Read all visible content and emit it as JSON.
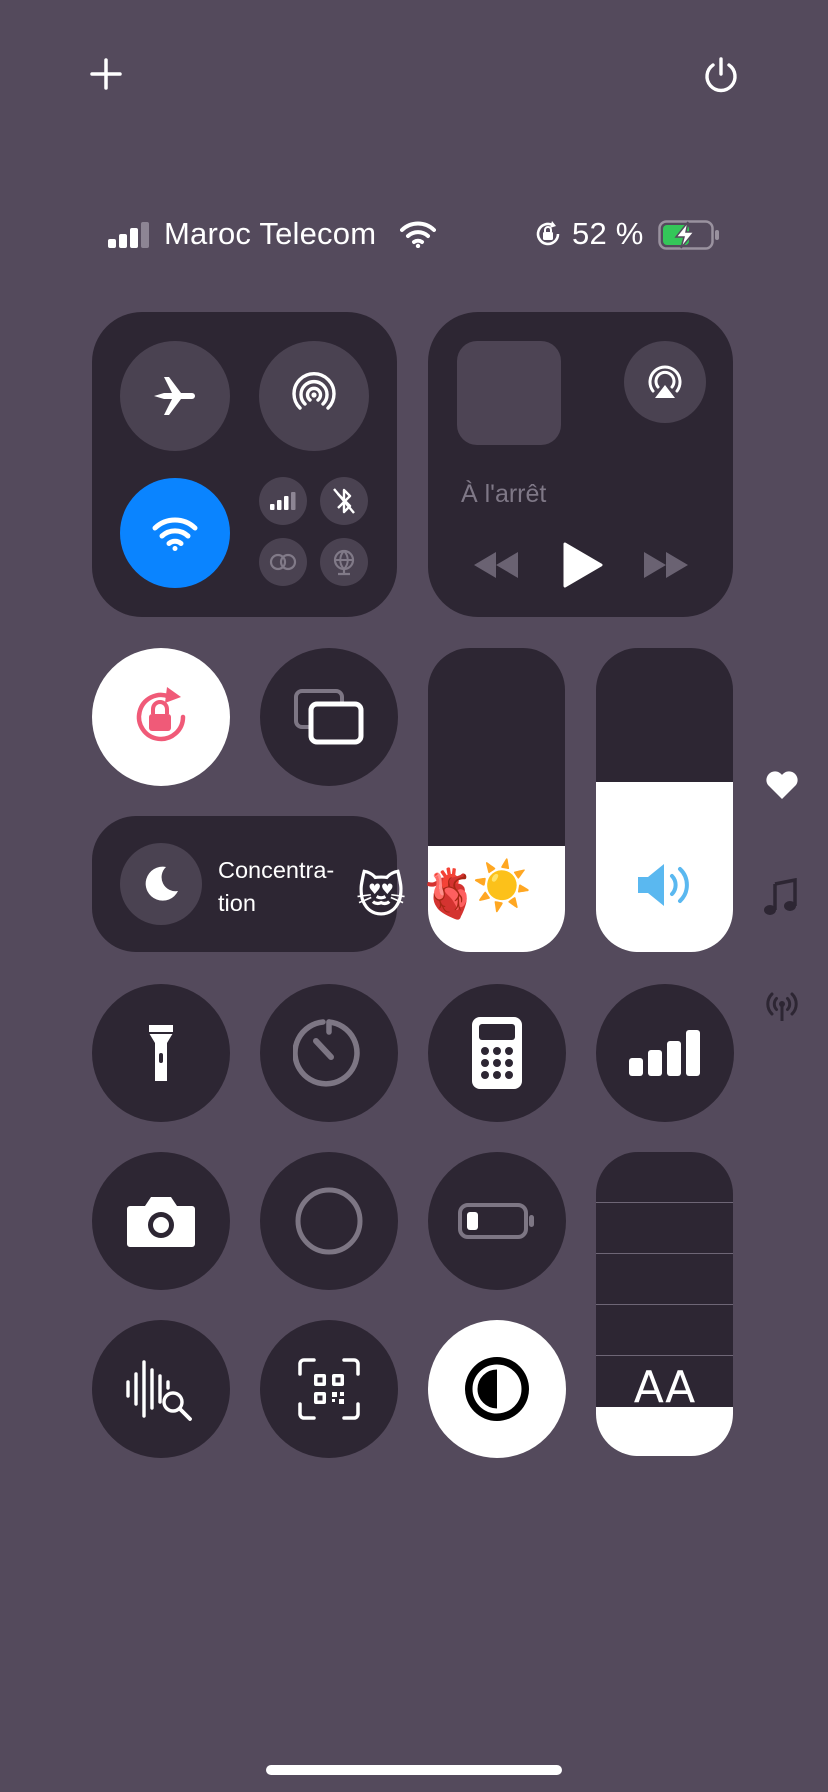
{
  "top": {
    "add_icon": "plus-icon",
    "power_icon": "power-icon"
  },
  "status": {
    "carrier": "Maroc Telecom",
    "battery_percent": "52 %",
    "signal_bars_lit": 3,
    "battery_level": 0.52,
    "charging": true
  },
  "connectivity": {
    "airplane_mode": false,
    "airdrop": false,
    "wifi": true,
    "cellular_data": false,
    "bluetooth": false,
    "accent": "#0a84ff"
  },
  "media": {
    "status": "À l'arrêt",
    "icons": [
      "airplay-icon",
      "rewind-icon",
      "play-icon",
      "fast-forward-icon"
    ]
  },
  "focus": {
    "label_line1": "Concentra-",
    "label_line2": "tion"
  },
  "emojis": {
    "cat": "😻",
    "heart": "🫀",
    "sun": "☀️"
  },
  "brightness": {
    "level": 0.35
  },
  "volume": {
    "level": 0.56
  },
  "text_size": {
    "label": "AA",
    "level": 0.16
  },
  "side_icons": [
    "heart-icon",
    "music-note-icon",
    "antenna-icon"
  ],
  "colors": {
    "background": "#544a5c",
    "tile": "#2d2633",
    "rotation_lock": "#f05a78",
    "white": "#ffffff"
  }
}
